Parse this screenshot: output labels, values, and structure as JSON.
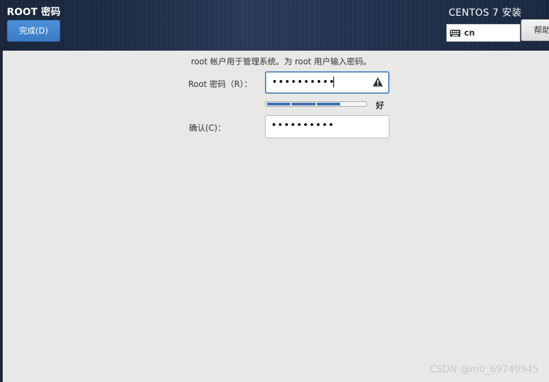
{
  "header": {
    "title": "ROOT 密码",
    "done_label": "完成(D)",
    "product_title": "CENTOS 7 安装",
    "keyboard_layout": "cn",
    "help_label": "帮助"
  },
  "form": {
    "intro": "root 帐户用于管理系统。为 root 用户输入密码。",
    "password_label": "Root 密码（R）：",
    "password_dots": "••••••••••",
    "confirm_label": "确认(C)：",
    "confirm_dots": "••••••••••",
    "strength_label": "好",
    "strength_segments_filled": 3,
    "strength_segments_total": 4
  },
  "watermark": "CSDN @m0_69749945",
  "colors": {
    "accent": "#3f6fb3",
    "focus_border": "#5b91c9",
    "header_bg": "#1e2d46"
  },
  "icons": {
    "keyboard": "keyboard-icon",
    "warning": "warning-icon"
  }
}
